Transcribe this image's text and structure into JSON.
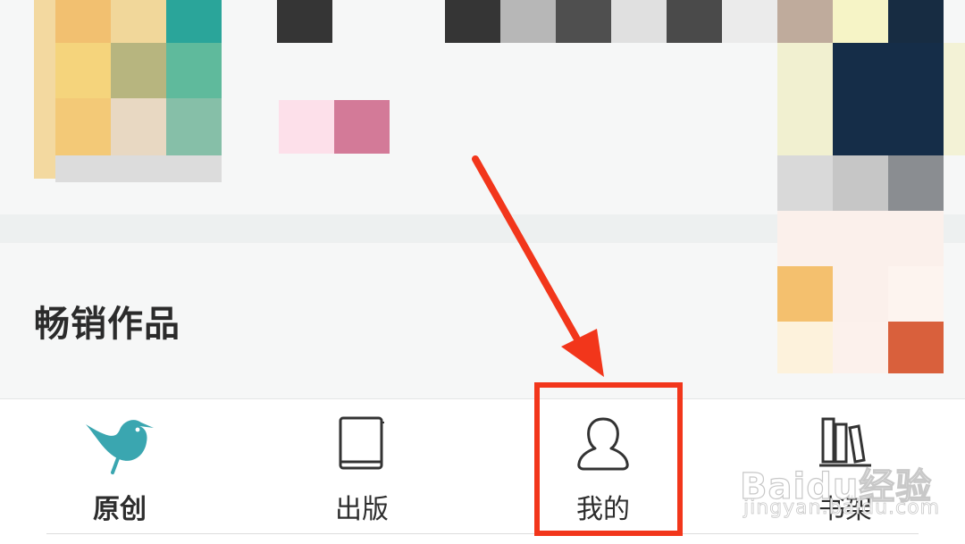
{
  "section": {
    "title": "畅销作品"
  },
  "tabs": [
    {
      "label": "原创",
      "icon": "bird-icon"
    },
    {
      "label": "出版",
      "icon": "book-icon"
    },
    {
      "label": "我的",
      "icon": "person-icon"
    },
    {
      "label": "书架",
      "icon": "bookshelf-icon"
    }
  ],
  "watermark": {
    "main": "Baidu经验",
    "sub": "jingyan.baidu.com"
  },
  "colors": {
    "accent": "#f2361b",
    "bird": "#3aa6b0",
    "text": "#2d2d2d"
  }
}
